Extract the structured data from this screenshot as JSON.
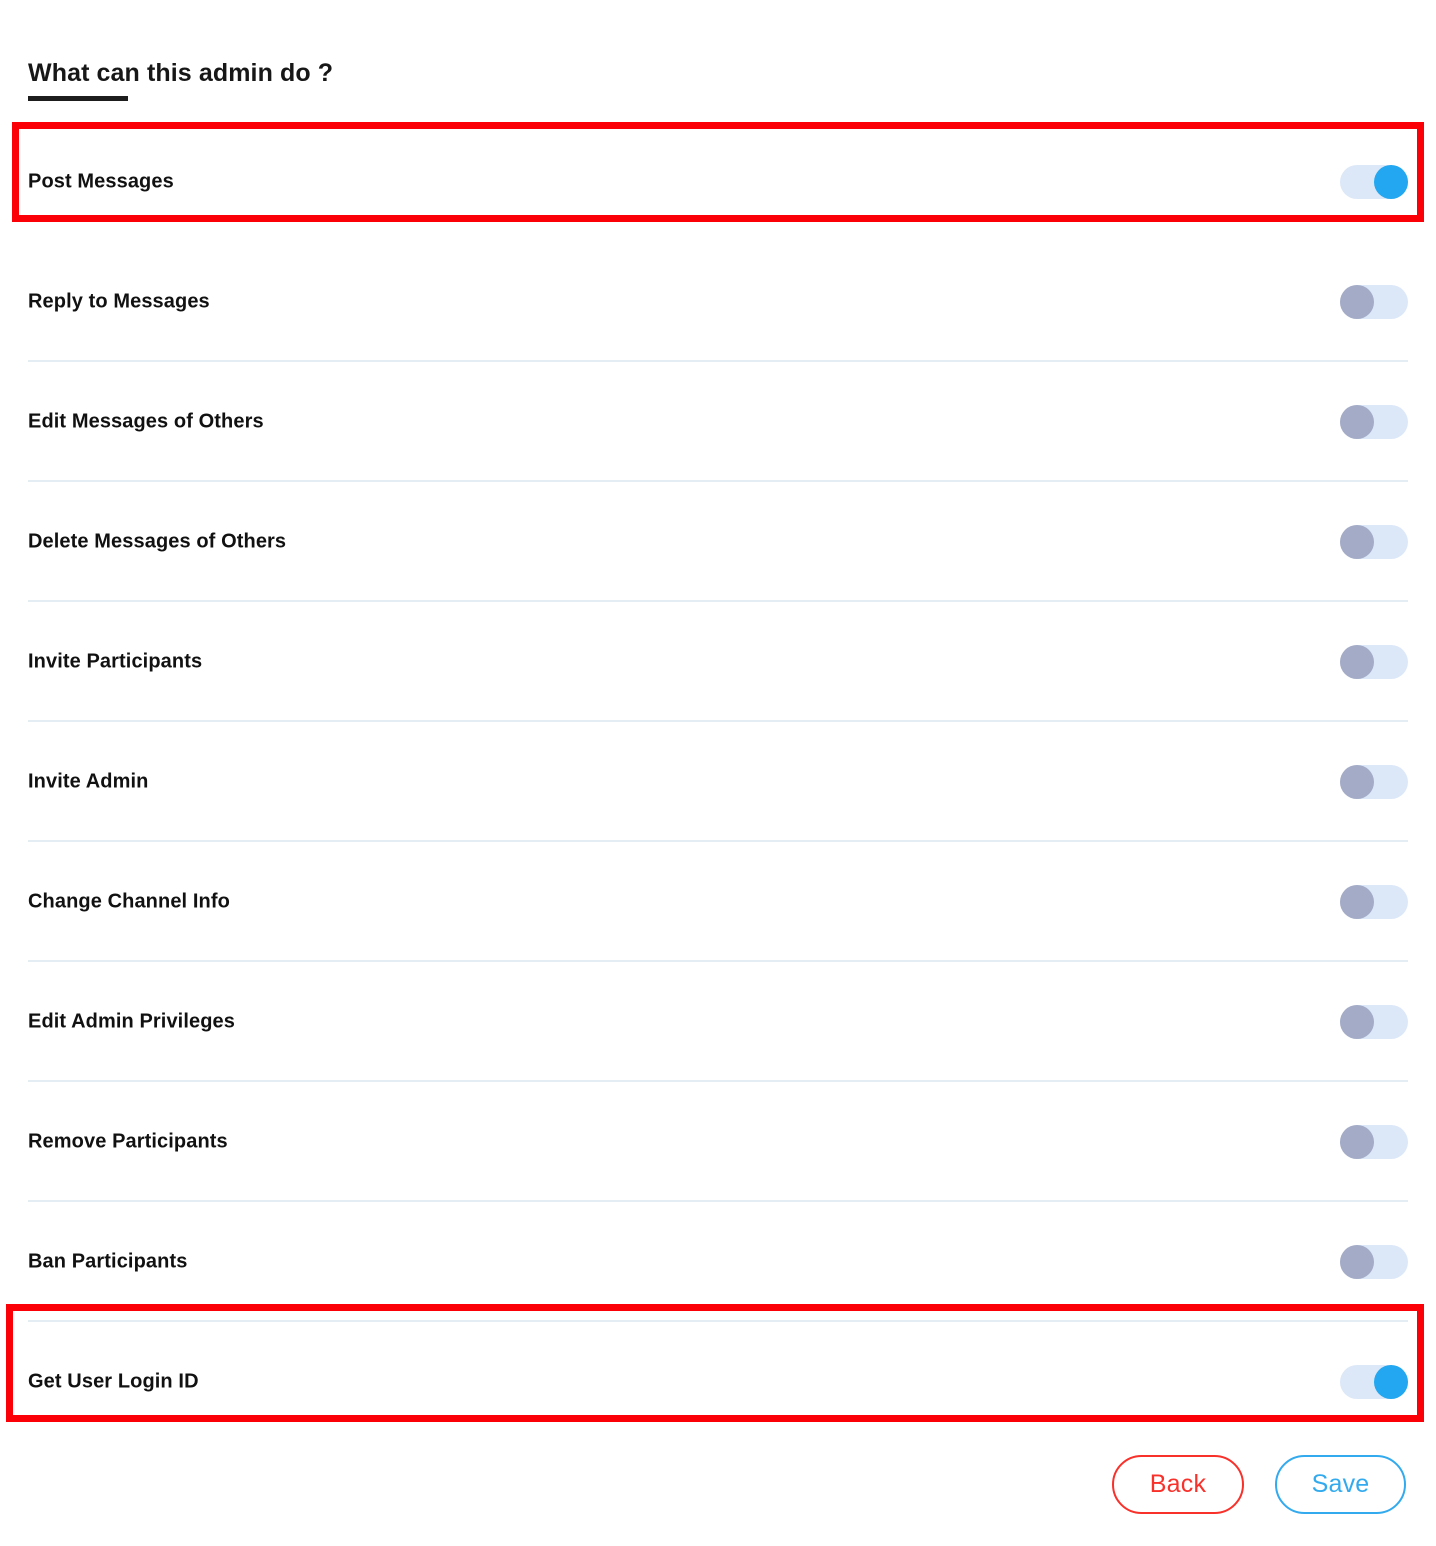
{
  "header": {
    "title": "What can this admin do ?"
  },
  "permissions": {
    "items": [
      {
        "label": "Post Messages",
        "state": "on",
        "highlighted": true,
        "divider": false
      },
      {
        "label": "Reply to Messages",
        "state": "off",
        "highlighted": false,
        "divider": true
      },
      {
        "label": "Edit Messages of Others",
        "state": "off",
        "highlighted": false,
        "divider": true
      },
      {
        "label": "Delete Messages of Others",
        "state": "off",
        "highlighted": false,
        "divider": true
      },
      {
        "label": "Invite Participants",
        "state": "off",
        "highlighted": false,
        "divider": true
      },
      {
        "label": "Invite Admin",
        "state": "off",
        "highlighted": false,
        "divider": true
      },
      {
        "label": "Change Channel Info",
        "state": "off",
        "highlighted": false,
        "divider": true
      },
      {
        "label": "Edit Admin Privileges",
        "state": "off",
        "highlighted": false,
        "divider": true
      },
      {
        "label": "Remove Participants",
        "state": "off",
        "highlighted": false,
        "divider": true
      },
      {
        "label": "Ban Participants",
        "state": "off",
        "highlighted": false,
        "divider": true
      },
      {
        "label": "Get User Login ID",
        "state": "on",
        "highlighted": true,
        "divider": false
      }
    ]
  },
  "footer": {
    "back_label": "Back",
    "save_label": "Save"
  },
  "colors": {
    "accent_blue": "#22a7f0",
    "toggle_track": "#dce8f8",
    "toggle_thumb_off": "#a3abc6",
    "highlight_red": "#fb0007",
    "back_red": "#f8312b",
    "save_blue": "#33aaee",
    "divider": "#e4edf4",
    "text": "#111111"
  }
}
